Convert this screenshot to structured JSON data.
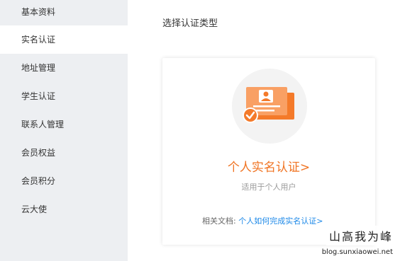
{
  "sidebar": {
    "items": [
      {
        "label": "基本资料"
      },
      {
        "label": "实名认证"
      },
      {
        "label": "地址管理"
      },
      {
        "label": "学生认证"
      },
      {
        "label": "联系人管理"
      },
      {
        "label": "会员权益"
      },
      {
        "label": "会员积分"
      },
      {
        "label": "云大使"
      }
    ]
  },
  "main": {
    "title": "选择认证类型",
    "card": {
      "icon": "id-card-verified-icon",
      "title": "个人实名认证>",
      "subtitle": "适用于个人用户",
      "doc_label": "相关文档:",
      "doc_link": "个人如何完成实名认证>"
    }
  },
  "watermark": {
    "brand": "山高我为峰",
    "url": "blog.sunxiaowei.net"
  },
  "colors": {
    "accent": "#f07423",
    "link": "#1b88e8",
    "sidebar_bg": "#edeff2",
    "check_badge": "#f07423"
  }
}
